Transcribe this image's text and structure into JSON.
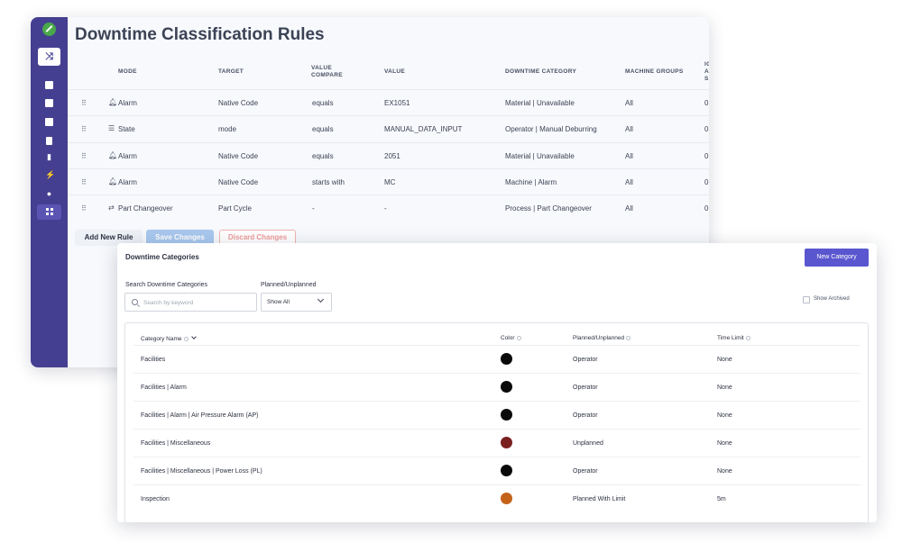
{
  "rules": {
    "title": "Downtime Classification Rules",
    "columns": [
      "MODE",
      "TARGET",
      "VALUE COMPARE",
      "VALUE",
      "DOWNTIME CATEGORY",
      "MACHINE GROUPS",
      "IG A S"
    ],
    "column_lines": {
      "value_compare": [
        "VALUE",
        "COMPARE"
      ],
      "cut_off": [
        "IG",
        "A",
        "S"
      ]
    },
    "rows": [
      {
        "mode_icon": "bell-icon",
        "mode": "Alarm",
        "target": "Native Code",
        "compare": "equals",
        "value": "EX1051",
        "category": "Material | Unavailable",
        "groups": "All",
        "extra": "0"
      },
      {
        "mode_icon": "list-icon",
        "mode": "State",
        "target": "mode",
        "compare": "equals",
        "value": "MANUAL_DATA_INPUT",
        "category": "Operator | Manual Deburring",
        "groups": "All",
        "extra": "0"
      },
      {
        "mode_icon": "bell-icon",
        "mode": "Alarm",
        "target": "Native Code",
        "compare": "equals",
        "value": "2051",
        "category": "Material | Unavailable",
        "groups": "All",
        "extra": "0"
      },
      {
        "mode_icon": "bell-icon",
        "mode": "Alarm",
        "target": "Native Code",
        "compare": "starts with",
        "value": "MC",
        "category": "Machine | Alarm",
        "groups": "All",
        "extra": "0"
      },
      {
        "mode_icon": "swap-icon",
        "mode": "Part Changeover",
        "target": "Part Cycle",
        "compare": "-",
        "value": "-",
        "category": "Process | Part Changeover",
        "groups": "All",
        "extra": "0"
      }
    ],
    "add_label": "Add New Rule",
    "save_label": "Save Changes",
    "discard_label": "Discard Changes"
  },
  "categories": {
    "title": "Downtime Categories",
    "new_label": "New Category",
    "search_label": "Search Downtime Categories",
    "search_placeholder": "Search by keyword",
    "planned_label": "Planned/Unplanned",
    "planned_value": "Show All",
    "archived_label": "Show Archived",
    "columns": {
      "name": "Category Name",
      "color": "Color",
      "planned": "Planned/Unplanned",
      "limit": "Time Limit"
    },
    "rows": [
      {
        "name": "Facilities",
        "color": "#0a0a0a",
        "planned": "Operator",
        "limit": "None"
      },
      {
        "name": "Facilities | Alarm",
        "color": "#0a0a0a",
        "planned": "Operator",
        "limit": "None"
      },
      {
        "name": "Facilities | Alarm | Air Pressure Alarm (AP)",
        "color": "#0a0a0a",
        "planned": "Operator",
        "limit": "None"
      },
      {
        "name": "Facilities | Miscellaneous",
        "color": "#7a2020",
        "planned": "Unplanned",
        "limit": "None"
      },
      {
        "name": "Facilities | Miscellaneous | Power Loss (PL)",
        "color": "#0a0a0a",
        "planned": "Operator",
        "limit": "None"
      },
      {
        "name": "Inspection",
        "color": "#c4621a",
        "planned": "Planned With Limit",
        "limit": "5m"
      }
    ]
  },
  "sidebar_icons": [
    "shuffle-icon",
    "factory-icon",
    "video-icon",
    "calendar-icon",
    "document-icon",
    "bar-chart-icon",
    "lightning-icon",
    "wrench-icon",
    "grid-icon"
  ]
}
